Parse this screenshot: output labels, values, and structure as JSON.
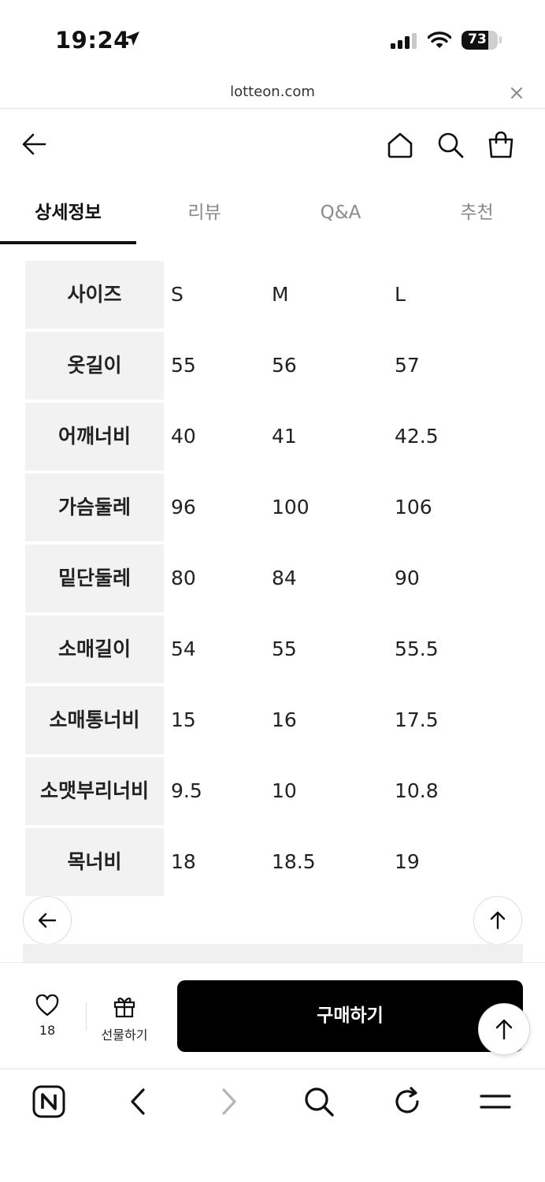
{
  "status": {
    "time": "19:24",
    "battery": "73",
    "battery_level": 0.73
  },
  "browser": {
    "url": "lotteon.com"
  },
  "tabs": [
    {
      "label": "상세정보",
      "active": true
    },
    {
      "label": "리뷰",
      "active": false
    },
    {
      "label": "Q&A",
      "active": false
    },
    {
      "label": "추천",
      "active": false
    }
  ],
  "size_table": {
    "columns": [
      "S",
      "M",
      "L"
    ],
    "header_label": "사이즈",
    "rows": [
      {
        "label": "옷길이",
        "values": [
          "55",
          "56",
          "57"
        ]
      },
      {
        "label": "어깨너비",
        "values": [
          "40",
          "41",
          "42.5"
        ]
      },
      {
        "label": "가슴둘레",
        "values": [
          "96",
          "100",
          "106"
        ]
      },
      {
        "label": "밑단둘레",
        "values": [
          "80",
          "84",
          "90"
        ]
      },
      {
        "label": "소매길이",
        "values": [
          "54",
          "55",
          "55.5"
        ]
      },
      {
        "label": "소매통너비",
        "values": [
          "15",
          "16",
          "17.5"
        ]
      },
      {
        "label": "소맷부리너비",
        "values": [
          "9.5",
          "10",
          "10.8"
        ]
      },
      {
        "label": "목너비",
        "values": [
          "18",
          "18.5",
          "19"
        ]
      }
    ]
  },
  "purchase_bar": {
    "like_count": "18",
    "gift_label": "선물하기",
    "buy_label": "구매하기"
  },
  "icons": {
    "header": [
      "back-arrow-icon",
      "home-icon",
      "search-icon",
      "shopping-bag-icon"
    ],
    "toolbar": [
      "naver-icon",
      "chevron-left-icon",
      "chevron-right-icon",
      "search-icon",
      "refresh-icon",
      "menu-icon"
    ]
  }
}
